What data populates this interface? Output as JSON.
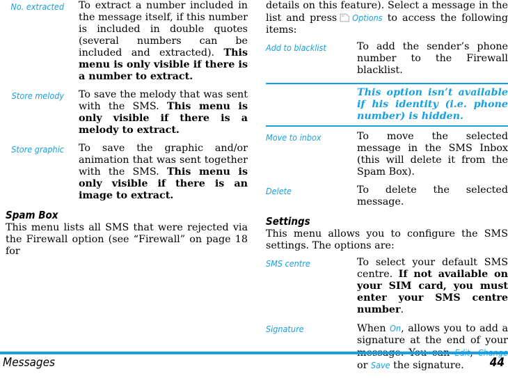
{
  "accent_color": "#15A0E1",
  "left_column": {
    "definitions": [
      {
        "term": "No. extracted",
        "desc_plain": "To extract a number included in the message itself, if this number is included in double quotes (several numbers can be included and extracted). ",
        "desc_bold": "This menu is only visible if there is a number to extract."
      },
      {
        "term": "Store melody",
        "desc_plain": "To save the melody that was sent with the SMS. ",
        "desc_bold": "This menu is only visible if there is a melody to extract."
      },
      {
        "term": "Store graphic",
        "desc_plain": "To save the graphic and/or animation that was sent together with the SMS. ",
        "desc_bold": "This menu is only visible if there is an image to extract."
      }
    ],
    "section": {
      "heading": "Spam Box",
      "paragraph": "This menu lists all SMS that were rejected via the Firewall option (see “Firewall” on page 18 for"
    }
  },
  "right_column": {
    "intro": {
      "before_icon": "details on this feature). Select a message in the list and press",
      "icon_name": "left-softkey-icon",
      "link": "Options",
      "after_link": "to access the following items:"
    },
    "definitions_spam": [
      {
        "term": "Add to blacklist",
        "desc_plain": "To add the sender’s phone number to the Firewall blacklist."
      },
      {
        "term": "Move to inbox",
        "desc_plain": "To move the selected message in the SMS Inbox (this will delete it from the Spam Box)."
      },
      {
        "term": "Delete",
        "desc_plain": "To delete the selected message."
      }
    ],
    "note": "This option isn’t available if his identity (i.e. phone number) is hidden.",
    "settings_section": {
      "heading": "Settings",
      "paragraph": "This menu allows you to configure the SMS settings. The options are:"
    },
    "definitions_settings": [
      {
        "term": "SMS centre",
        "desc_plain": "To select your default SMS centre. ",
        "desc_bold": "If not available on your SIM card, you must enter your SMS centre number",
        "desc_tail": "."
      },
      {
        "term": "Signature",
        "seg_1": "When ",
        "link_on": "On",
        "seg_2": ", allows you to add a signature at the end of your message. You can ",
        "link_edit": "Edit",
        "seg_3": ", ",
        "link_change": "Change",
        "seg_4": " or ",
        "link_save": "Save",
        "seg_5": " the signature."
      }
    ]
  },
  "footer": {
    "chapter": "Messages",
    "page_number": "44"
  }
}
